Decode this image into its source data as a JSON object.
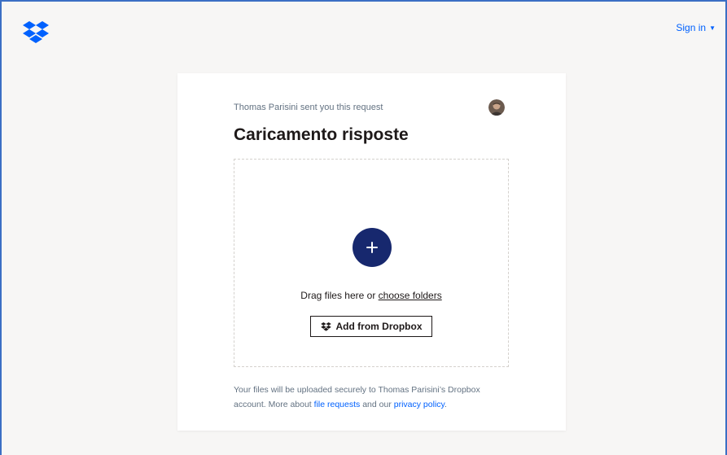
{
  "header": {
    "signin_label": "Sign in",
    "logo_icon": "dropbox-logo-icon",
    "caret_icon": "chevron-down-icon"
  },
  "request": {
    "sender_text": "Thomas Parisini sent you this request",
    "title": "Caricamento risposte",
    "add_icon": "plus-icon",
    "drag_text": "Drag files here or",
    "choose_folders": "choose folders",
    "add_from_dropbox": "Add from Dropbox",
    "footer_text_1": "Your files will be uploaded securely to Thomas Parisini’s Dropbox account. More about",
    "file_requests_link": "file requests",
    "footer_text_2": "and our",
    "privacy_link": "privacy policy",
    "footer_text_3": "."
  },
  "colors": {
    "accent": "#0061fe",
    "plus_button": "#17286e",
    "background": "#f7f6f5"
  }
}
